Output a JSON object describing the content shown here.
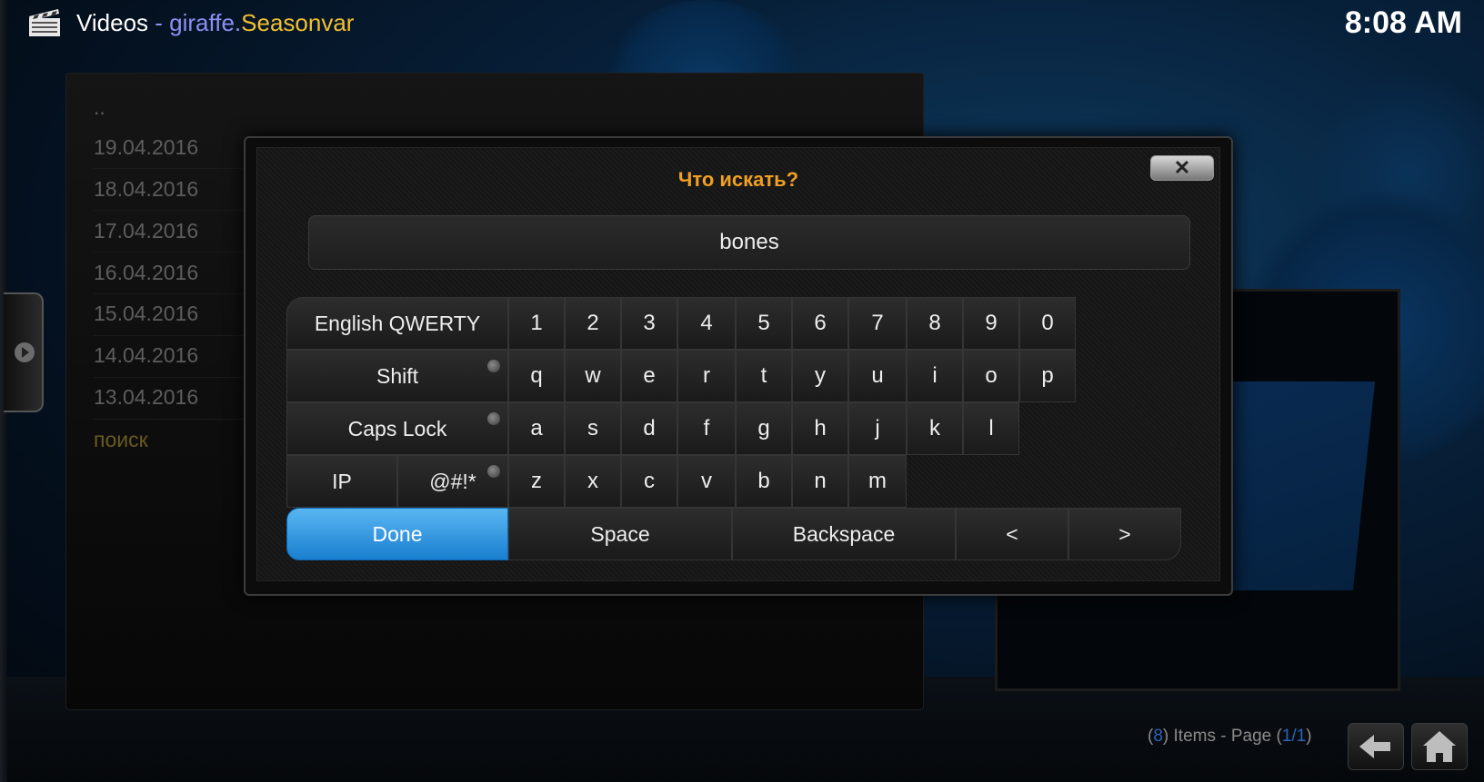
{
  "header": {
    "section": "Videos",
    "separator": " - ",
    "plugin_part1": "giraffe.",
    "plugin_part2": "Seasonvar",
    "clock": "8:08 AM"
  },
  "list": {
    "items": [
      {
        "label": ".."
      },
      {
        "label": "19.04.2016"
      },
      {
        "label": "18.04.2016"
      },
      {
        "label": "17.04.2016"
      },
      {
        "label": "16.04.2016"
      },
      {
        "label": "15.04.2016"
      },
      {
        "label": "14.04.2016"
      },
      {
        "label": "13.04.2016"
      },
      {
        "label": "поиск"
      }
    ]
  },
  "dialog": {
    "heading": "Что искать?",
    "close_symbol": "✕",
    "input_value": "bones",
    "keys": {
      "layout": "English QWERTY",
      "row1": [
        "1",
        "2",
        "3",
        "4",
        "5",
        "6",
        "7",
        "8",
        "9",
        "0"
      ],
      "shift": "Shift",
      "row2": [
        "q",
        "w",
        "e",
        "r",
        "t",
        "y",
        "u",
        "i",
        "o",
        "p"
      ],
      "caps": "Caps Lock",
      "row3": [
        "a",
        "s",
        "d",
        "f",
        "g",
        "h",
        "j",
        "k",
        "l"
      ],
      "ip": "IP",
      "symbols": "@#!*",
      "row4": [
        "z",
        "x",
        "c",
        "v",
        "b",
        "n",
        "m"
      ],
      "done": "Done",
      "space": "Space",
      "backspace": "Backspace",
      "left": "<",
      "right": ">"
    }
  },
  "footer": {
    "open_paren": "(",
    "item_count": "8",
    "items_text": ") Items - Page (",
    "page_current": "1",
    "page_sep": "/",
    "page_total": "1",
    "close_paren": ")"
  },
  "icons": {
    "logo": "clapperboard-icon",
    "back": "back-arrow-icon",
    "home": "home-icon"
  },
  "colors": {
    "accent_orange": "#f0a020",
    "plugin_blue": "#8d8ff2",
    "plugin_yellow": "#f0c030",
    "done_blue": "#2a8ee0"
  }
}
